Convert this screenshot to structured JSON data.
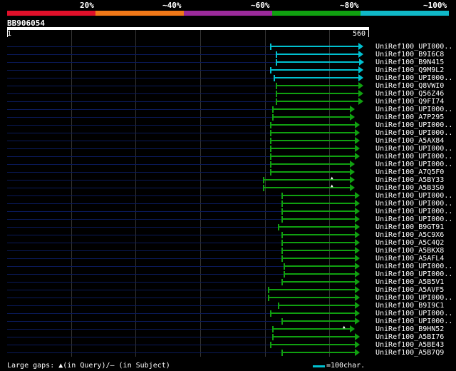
{
  "legend": {
    "labels": [
      "20%",
      "~40%",
      "~60%",
      "~80%",
      "~100%"
    ],
    "colors": [
      "#e0102a",
      "#f07818",
      "#9a2a9a",
      "#10a010",
      "#10b8c8"
    ]
  },
  "query": {
    "id": "BB906054",
    "start": "1",
    "end": "560"
  },
  "hits": [
    {
      "label": "UniRef100_UPI000..",
      "color": "#00c0d0"
    },
    {
      "label": "UniRef100_B9I6C8",
      "color": "#00c0d0"
    },
    {
      "label": "UniRef100_B9N415",
      "color": "#00c0d0"
    },
    {
      "label": "UniRef100_Q9M9L2",
      "color": "#00c0d0"
    },
    {
      "label": "UniRef100_UPI000..",
      "color": "#00c0d0"
    },
    {
      "label": "UniRef100_Q8VWI0",
      "color": "#10a010"
    },
    {
      "label": "UniRef100_Q56Z46",
      "color": "#10a010"
    },
    {
      "label": "UniRef100_Q9FI74",
      "color": "#10a010"
    },
    {
      "label": "UniRef100_UPI000..",
      "color": "#10a010"
    },
    {
      "label": "UniRef100_A7P295",
      "color": "#10a010"
    },
    {
      "label": "UniRef100_UPI000..",
      "color": "#10a010"
    },
    {
      "label": "UniRef100_UPI000..",
      "color": "#10a010"
    },
    {
      "label": "UniRef100_A5AX84",
      "color": "#10a010"
    },
    {
      "label": "UniRef100_UPI000..",
      "color": "#10a010"
    },
    {
      "label": "UniRef100_UPI000..",
      "color": "#10a010"
    },
    {
      "label": "UniRef100_UPI000..",
      "color": "#10a010"
    },
    {
      "label": "UniRef100_A7Q5F0",
      "color": "#10a010"
    },
    {
      "label": "UniRef100_A5BY33",
      "color": "#10a010"
    },
    {
      "label": "UniRef100_A5B3S0",
      "color": "#10a010"
    },
    {
      "label": "UniRef100_UPI000..",
      "color": "#10a010"
    },
    {
      "label": "UniRef100_UPI000..",
      "color": "#10a010"
    },
    {
      "label": "UniRef100_UPI000..",
      "color": "#10a010"
    },
    {
      "label": "UniRef100_UPI000..",
      "color": "#10a010"
    },
    {
      "label": "UniRef100_B9GT91",
      "color": "#10a010"
    },
    {
      "label": "UniRef100_A5C9X6",
      "color": "#10a010"
    },
    {
      "label": "UniRef100_A5C4Q2",
      "color": "#10a010"
    },
    {
      "label": "UniRef100_A5BKX8",
      "color": "#10a010"
    },
    {
      "label": "UniRef100_A5AFL4",
      "color": "#10a010"
    },
    {
      "label": "UniRef100_UPI000..",
      "color": "#10a010"
    },
    {
      "label": "UniRef100_UPI000..",
      "color": "#10a010"
    },
    {
      "label": "UniRef100_A5B5V1",
      "color": "#10a010"
    },
    {
      "label": "UniRef100_A5AVF5",
      "color": "#10a010"
    },
    {
      "label": "UniRef100_UPI000..",
      "color": "#10a010"
    },
    {
      "label": "UniRef100_B9I9C1",
      "color": "#10a010"
    },
    {
      "label": "UniRef100_UPI000..",
      "color": "#10a010"
    },
    {
      "label": "UniRef100_UPI000..",
      "color": "#10a010"
    },
    {
      "label": "UniRef100_B9HN52",
      "color": "#10a010"
    },
    {
      "label": "UniRef100_A5BI76",
      "color": "#10a010"
    },
    {
      "label": "UniRef100_A5BE43",
      "color": "#10a010"
    },
    {
      "label": "UniRef100_A5B7Q9",
      "color": "#10a010"
    }
  ],
  "footer": {
    "gaps_text": "Large gaps: ▲(in Query)/— (in Subject)",
    "scale_text": "=100char."
  }
}
